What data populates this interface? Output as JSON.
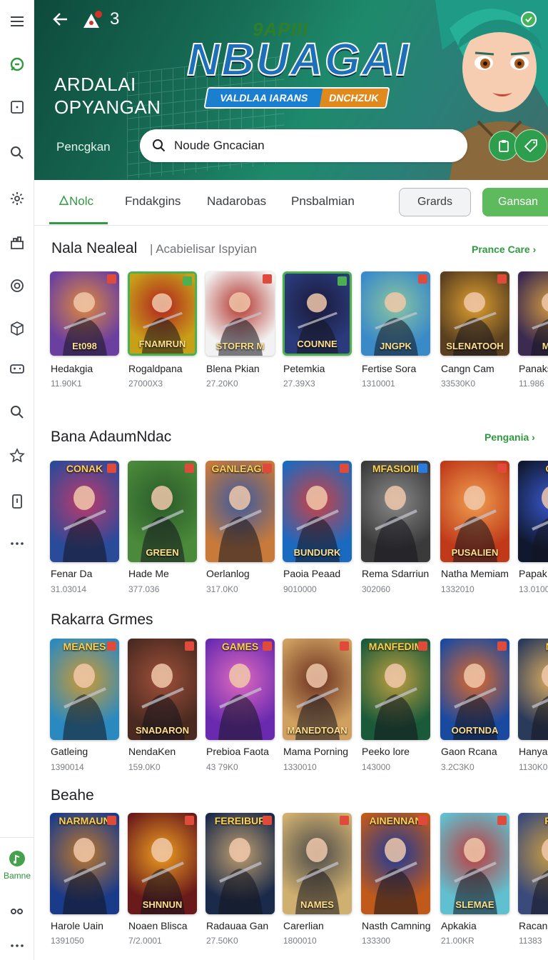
{
  "hero": {
    "count": "3",
    "title_line1": "ARDALAI",
    "title_line2": "OPYANGAN",
    "subtitle": "Pencgkan",
    "logo_top": "9APIII",
    "logo_main": "NBUAGAI",
    "logo_strip_left": "VALDLAA IARANS",
    "logo_strip_right": "DNCHZUK",
    "search_value": "Noude Gncacian"
  },
  "tabs": {
    "items": [
      "Nolc",
      "Fndakgins",
      "Nadarobas",
      "Pnsbalmian"
    ],
    "outline_button": "Grards",
    "green_button": "Gansan"
  },
  "rail": {
    "bottom_label": "Bamne"
  },
  "sections": [
    {
      "title": "Nala Nealeal",
      "subtitle": "Acabielisar Ispyian",
      "link": "Prance Care",
      "cards": [
        {
          "name": "Hedakgia",
          "meta": "11.90K1",
          "caption": "Et098"
        },
        {
          "name": "Rogaldpana",
          "meta": "27000X3",
          "caption": "FNAMRUN"
        },
        {
          "name": "Blena Pkian",
          "meta": "27.20K0",
          "caption": "STOFRR M"
        },
        {
          "name": "Petemkia",
          "meta": "27.39X3",
          "caption": "COUNNE"
        },
        {
          "name": "Fertise Sora",
          "meta": "1310001",
          "caption": "JNGPK"
        },
        {
          "name": "Cangn Cam",
          "meta": "33530K0",
          "caption": "SLENATOOH"
        },
        {
          "name": "Panaks",
          "meta": "11.986",
          "caption": "MAN"
        }
      ]
    },
    {
      "title": "Bana AdaumNdac",
      "link": "Pengania",
      "cards": [
        {
          "name": "Fenar Da",
          "meta": "31.03014",
          "caption": "CONAK"
        },
        {
          "name": "Hade Me",
          "meta": "377.036",
          "caption": "GREEN"
        },
        {
          "name": "Oerlanlog",
          "meta": "317.0K0",
          "caption": "GANLEAGR"
        },
        {
          "name": "Paoia Peaad",
          "meta": "9010000",
          "caption": "BUNDURK"
        },
        {
          "name": "Rema Sdarriun",
          "meta": "302060",
          "caption": "MFASIOIII"
        },
        {
          "name": "Natha Memiam",
          "meta": "1332010",
          "caption": "PUSALIEN"
        },
        {
          "name": "Papak",
          "meta": "13.0100",
          "caption": "GE"
        }
      ]
    },
    {
      "title": "Rakarra Grmes",
      "cards": [
        {
          "name": "Gatleing",
          "meta": "1390014",
          "caption": "MEANES"
        },
        {
          "name": "NendaKen",
          "meta": "159.0K0",
          "caption": "SNADARON"
        },
        {
          "name": "Prebioa Faota",
          "meta": "43 79K0",
          "caption": "GAMES"
        },
        {
          "name": "Mama Porning",
          "meta": "1330010",
          "caption": "MANEDTOAN"
        },
        {
          "name": "Peeko lore",
          "meta": "143000",
          "caption": "MANFEDIM"
        },
        {
          "name": "Gaon Rcana",
          "meta": "3.2C3K0",
          "caption": "OORTNDA"
        },
        {
          "name": "Hanyal",
          "meta": "1130K0",
          "caption": "NE"
        }
      ]
    },
    {
      "title": "Beahe",
      "cards": [
        {
          "name": "Harole Uain",
          "meta": "1391050",
          "caption": "NARMAUN"
        },
        {
          "name": "Noaen Blisca",
          "meta": "7/2.0001",
          "caption": "SHNNUN"
        },
        {
          "name": "Radauaa Gan",
          "meta": "27.50K0",
          "caption": "FEREIBUR"
        },
        {
          "name": "Carerlian",
          "meta": "1800010",
          "caption": "NAMES"
        },
        {
          "name": "Nasth Camning",
          "meta": "133300",
          "caption": "AINENNAN"
        },
        {
          "name": "Apkakia",
          "meta": "21.00KR",
          "caption": "SLEMAE"
        },
        {
          "name": "Racan",
          "meta": "11383",
          "caption": "FIN"
        }
      ]
    }
  ]
}
